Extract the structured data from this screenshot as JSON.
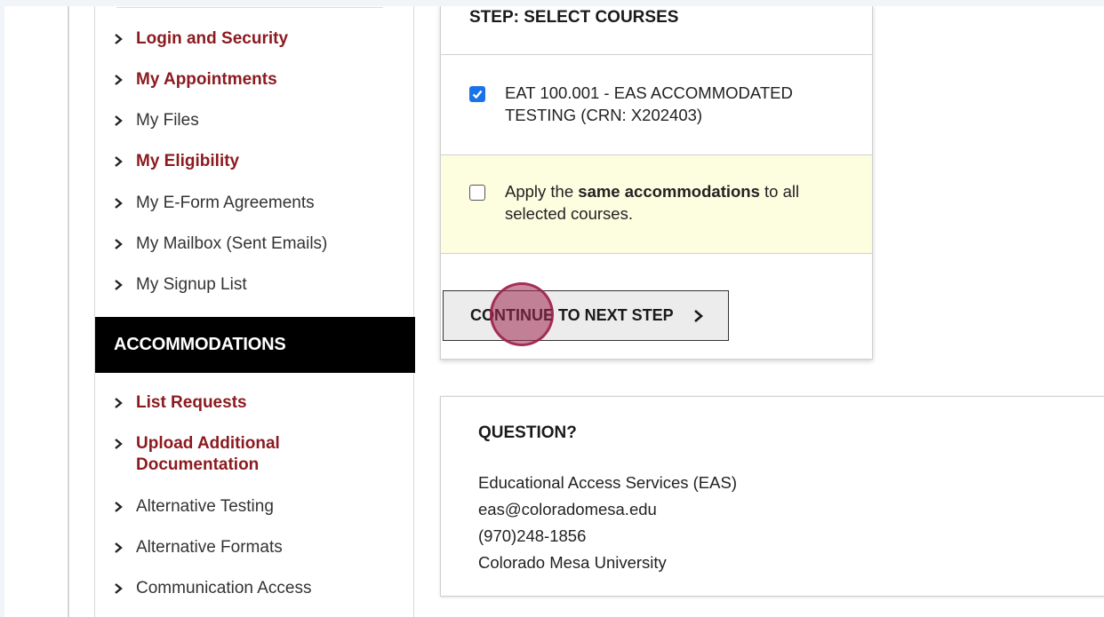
{
  "sidebar": {
    "items": [
      {
        "label": "Login and Security",
        "style": "red"
      },
      {
        "label": "My Appointments",
        "style": "red"
      },
      {
        "label": "My Files",
        "style": "plain"
      },
      {
        "label": "My Eligibility",
        "style": "red"
      },
      {
        "label": "My E-Form Agreements",
        "style": "plain"
      },
      {
        "label": "My Mailbox (Sent Emails)",
        "style": "plain"
      },
      {
        "label": "My Signup List",
        "style": "plain"
      }
    ],
    "accommodations_header": "ACCOMMODATIONS",
    "accommodation_items": [
      {
        "label": "List Requests",
        "style": "red"
      },
      {
        "label": "Upload Additional Documentation",
        "style": "red"
      },
      {
        "label": "Alternative Testing",
        "style": "plain"
      },
      {
        "label": "Alternative Formats",
        "style": "plain"
      },
      {
        "label": "Communication Access",
        "style": "plain"
      }
    ],
    "icon": "chevron-right-icon"
  },
  "courses": {
    "step_title": "STEP: SELECT COURSES",
    "course_option": {
      "label": "EAT 100.001 - EAS ACCOMMODATED TESTING (CRN: X202403)",
      "checked": true
    },
    "same_accommodations": {
      "prefix": "Apply the ",
      "bold": "same accommodations",
      "suffix": " to all selected courses.",
      "checked": false
    },
    "continue_label": "CONTINUE TO NEXT STEP",
    "continue_icon": "chevron-right-icon"
  },
  "question": {
    "title": "QUESTION?",
    "lines": [
      "Educational Access Services (EAS)",
      "eas@coloradomesa.edu",
      "(970)248-1856",
      "Colorado Mesa University"
    ]
  },
  "colors": {
    "link_red": "#8b1a1f",
    "header_black": "#000000",
    "checkbox_blue": "#1a73e8",
    "highlight_yellow": "#fdfde0",
    "click_marker": "#9e284e"
  }
}
